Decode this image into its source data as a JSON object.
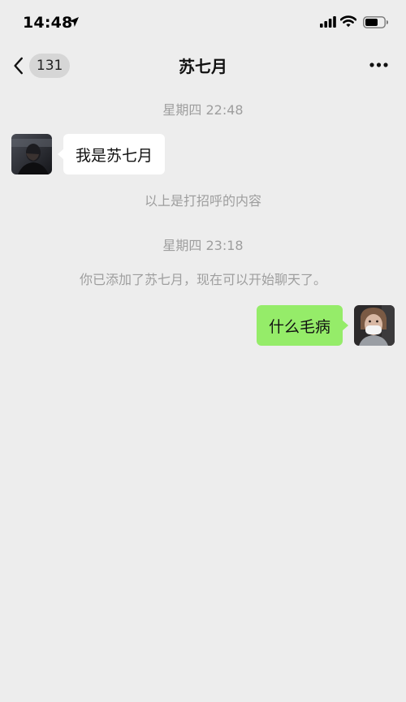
{
  "status_bar": {
    "time": "14:48",
    "icons": [
      "location-arrow-icon",
      "signal-icon",
      "wifi-icon",
      "battery-icon"
    ]
  },
  "nav": {
    "back_icon": "chevron-left-icon",
    "unread_count": "131",
    "title": "苏七月",
    "more_icon": "more-dots-icon"
  },
  "messages": [
    {
      "kind": "time",
      "text": "星期四 22:48"
    },
    {
      "kind": "incoming",
      "sender": "苏七月",
      "text": "我是苏七月"
    },
    {
      "kind": "system",
      "text": "以上是打招呼的内容"
    },
    {
      "kind": "time",
      "text": "星期四 23:18"
    },
    {
      "kind": "system",
      "text": "你已添加了苏七月，现在可以开始聊天了。"
    },
    {
      "kind": "outgoing",
      "text": "什么毛病"
    }
  ],
  "colors": {
    "background": "#ededed",
    "incoming_bubble": "#ffffff",
    "outgoing_bubble": "#95ec69",
    "system_text": "#9e9e9e"
  }
}
